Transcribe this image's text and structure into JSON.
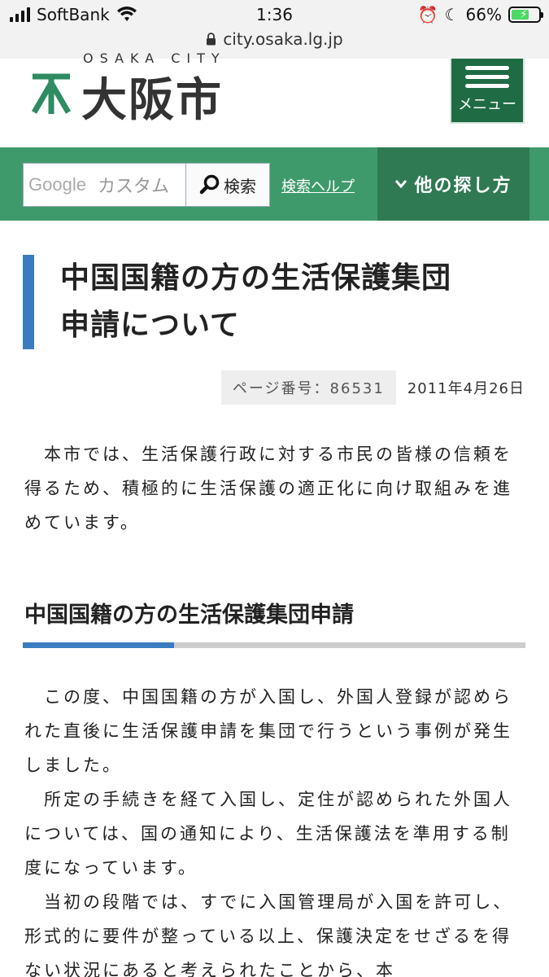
{
  "status_bar": {
    "carrier": "SoftBank",
    "time": "1:36",
    "battery": "66%",
    "battery_level": 0.66,
    "url": "city.osaka.lg.jp"
  },
  "header": {
    "logo_sub": "OSAKA CITY",
    "logo_text": "大阪市",
    "menu_label": "メニュー"
  },
  "search": {
    "google_label": "Google",
    "placeholder": "カスタム",
    "button_label": "検索",
    "help_link": "検索ヘルプ",
    "other_ways": "他の探し方"
  },
  "article": {
    "title_line1": "中国国籍の方の生活保護集団",
    "title_line2": "申請について",
    "page_number": "ページ番号：86531",
    "date": "2011年4月26日",
    "intro": "　本市では、生活保護行政に対する市民の皆様の信頼を得るため、積極的に生活保護の適正化に向け取組みを進めています。",
    "section_heading": "中国国籍の方の生活保護集団申請",
    "p1": "　この度、中国国籍の方が入国し、外国人登録が認められた直後に生活保護申請を集団で行うという事例が発生しました。",
    "p2": "　所定の手続きを経て入国し、定住が認められた外国人については、国の通知により、生活保護法を準用する制度になっています。",
    "p3": "　当初の段階では、すでに入国管理局が入国を許可し、形式的に要件が整っている以上、保護決定をせざるを得ない状況にあると考えられたことから、本"
  },
  "colors": {
    "green": "#3f9a6b",
    "dark_green": "#2f7a53",
    "accent_blue": "#3b7bbf"
  }
}
